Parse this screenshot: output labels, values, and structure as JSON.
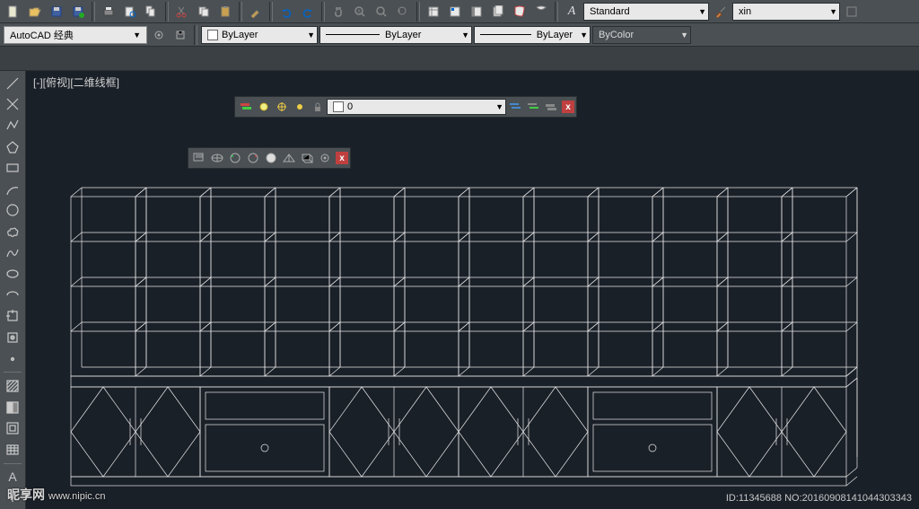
{
  "toolbar1": {
    "textstyle_label": "Standard",
    "annostyle_label": "xin"
  },
  "toolbar2": {
    "workspace": "AutoCAD 经典",
    "layer_dd": "ByLayer",
    "linetype_dd": "ByLayer",
    "lineweight_dd": "ByLayer",
    "plotstyle_dd": "ByColor"
  },
  "viewport": {
    "label": "[-][俯视][二维线框]"
  },
  "float_layer": {
    "current": "0"
  },
  "float_visual": {
    "close": "x"
  },
  "float_layer_close": "x",
  "watermark": {
    "brand": "昵享网",
    "url": "www.nipic.cn",
    "id_meta": "ID:11345688 NO:20160908141044303343"
  }
}
